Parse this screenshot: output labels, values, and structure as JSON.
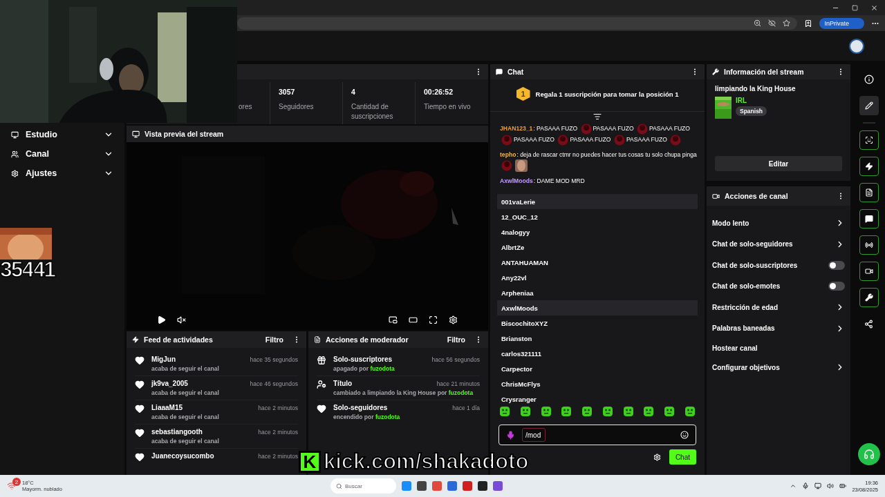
{
  "browser": {
    "badge": "InPrivate"
  },
  "sidebar": {
    "items": [
      {
        "label": "Estudio",
        "expanded": false
      },
      {
        "label": "Canal",
        "expanded": false
      },
      {
        "label": "Ajustes",
        "expanded": false
      }
    ]
  },
  "stats": [
    {
      "label": "ores"
    },
    {
      "value": "3057",
      "label": "Seguidores"
    },
    {
      "value": "4",
      "label": "Cantidad de suscripciones"
    },
    {
      "value": "00:26:52",
      "label": "Tiempo en vivo"
    }
  ],
  "preview": {
    "title": "Vista previa del stream"
  },
  "activity_feed": {
    "title": "Feed de actividades",
    "filter": "Filtro",
    "items": [
      {
        "name": "MigJun",
        "detail": "acaba de seguir el canal",
        "time": "hace 35 segundos"
      },
      {
        "name": "jk9va_2005",
        "detail": "acaba de seguir el canal",
        "time": "hace 46 segundos"
      },
      {
        "name": "LiaaaM15",
        "detail": "acaba de seguir el canal",
        "time": "hace 2 minutos"
      },
      {
        "name": "sebastiangooth",
        "detail": "acaba de seguir el canal",
        "time": "hace 2 minutos"
      },
      {
        "name": "Juanecoysucombo",
        "time": "hace 2 minutos"
      }
    ]
  },
  "mod_actions": {
    "title": "Acciones de moderador",
    "filter": "Filtro",
    "items": [
      {
        "kind": "gift",
        "action": "Solo-suscriptores",
        "detail": "apagado por",
        "user": "fuzodota",
        "time": "hace 56 segundos"
      },
      {
        "kind": "title",
        "action": "Título",
        "detail": "cambiado a **limpiando la King House** por",
        "user": "fuzodota",
        "time": "hace 21 minutos"
      },
      {
        "kind": "heart",
        "action": "Solo-seguidores",
        "detail": "encendido por",
        "user": "fuzodota",
        "time": "hace 1 día"
      }
    ]
  },
  "chat": {
    "title": "Chat",
    "pinned": {
      "rank": "1",
      "text": "Regala 1 suscripción para tomar la posición 1"
    },
    "messages": [
      {
        "user": "JHAN123_1",
        "separator": ":",
        "color": "#f0a030",
        "parts": [
          {
            "kind": "text",
            "text": "PASAAA FUZO"
          },
          {
            "kind": "emote"
          },
          {
            "kind": "text",
            "text": "PASAAA FUZO"
          },
          {
            "kind": "emote"
          },
          {
            "kind": "text",
            "text": "PASAAA FUZO"
          },
          {
            "kind": "emote"
          },
          {
            "kind": "text",
            "text": "PASAAA FUZO"
          },
          {
            "kind": "emote"
          },
          {
            "kind": "text",
            "text": "PASAAA FUZO"
          },
          {
            "kind": "emote"
          },
          {
            "kind": "text",
            "text": "PASAAA FUZO"
          },
          {
            "kind": "emote"
          }
        ]
      },
      {
        "user": "tepho",
        "separator": ":",
        "color": "#f0b840",
        "parts": [
          {
            "kind": "text",
            "text": "deja de rascar ctmr no puedes hacer tus cosas tu solo chupa pinga"
          },
          {
            "kind": "emote"
          },
          {
            "kind": "sticker"
          }
        ]
      },
      {
        "user": "AxwlMoods",
        "separator": ":",
        "color": "#c49cff",
        "parts": [
          {
            "kind": "text",
            "text": "DAME MOD MRD"
          }
        ]
      }
    ],
    "suggestions": [
      {
        "name": "001vaLerie",
        "highlighted": true
      },
      {
        "name": "12_OUC_12",
        "highlighted": false
      },
      {
        "name": "4nalogyy",
        "highlighted": false
      },
      {
        "name": "AlbrtZe",
        "highlighted": false
      },
      {
        "name": "ANTAHUAMAN",
        "highlighted": false
      },
      {
        "name": "Any22vl",
        "highlighted": false
      },
      {
        "name": "Arpheniaa",
        "highlighted": false
      },
      {
        "name": "AxwlMoods",
        "highlighted": true
      },
      {
        "name": "BiscochitoXYZ",
        "highlighted": false
      },
      {
        "name": "Brianston",
        "highlighted": false
      },
      {
        "name": "carlos321111",
        "highlighted": false
      },
      {
        "name": "Carpector",
        "highlighted": false
      },
      {
        "name": "ChrisMcFlys",
        "highlighted": false
      },
      {
        "name": "Crysranger",
        "highlighted": false
      }
    ],
    "input": {
      "value": "/mod"
    },
    "send": "Chat"
  },
  "stream_info": {
    "title": "Información del stream",
    "stream_title": "limpiando la King House",
    "category": "IRL",
    "tag": "Spanish",
    "edit": "Editar"
  },
  "channel_actions": {
    "title": "Acciones de canal",
    "items": [
      {
        "kind": "link",
        "label": "Modo lento"
      },
      {
        "kind": "link",
        "label": "Chat de solo-seguidores"
      },
      {
        "kind": "toggle",
        "label": "Chat de solo-suscriptores",
        "on": false
      },
      {
        "kind": "toggle",
        "label": "Chat de solo-emotes",
        "on": false
      },
      {
        "kind": "link",
        "label": "Restricción de edad"
      },
      {
        "kind": "link",
        "label": "Palabras baneadas"
      },
      {
        "kind": "plain",
        "label": "Hostear canal"
      },
      {
        "kind": "link",
        "label": "Configurar objetivos"
      }
    ]
  },
  "rail": {
    "items": [
      {
        "kind": "info",
        "selected": false,
        "pinned": false
      },
      {
        "kind": "edit",
        "selected": true,
        "pinned": false
      },
      {
        "kind": "scan",
        "selected": false,
        "pinned": true
      },
      {
        "kind": "bolt",
        "selected": false,
        "pinned": true
      },
      {
        "kind": "notes",
        "selected": false,
        "pinned": true
      },
      {
        "kind": "chat",
        "selected": false,
        "pinned": true
      },
      {
        "kind": "broadcast",
        "selected": false,
        "pinned": true
      },
      {
        "kind": "camera",
        "selected": false,
        "pinned": true
      },
      {
        "kind": "wrench",
        "selected": false,
        "pinned": true
      },
      {
        "kind": "nodes",
        "selected": false,
        "pinned": false
      }
    ]
  },
  "overlays": {
    "counter": "35441",
    "logo_letter": "K",
    "link": "kick.com/shakadoto"
  },
  "taskbar": {
    "weather_badge": "2",
    "temperature": "18°C",
    "weather": "Mayorm. nublado",
    "search": "Buscar",
    "time": "19:36",
    "date": "23/08/2025"
  }
}
